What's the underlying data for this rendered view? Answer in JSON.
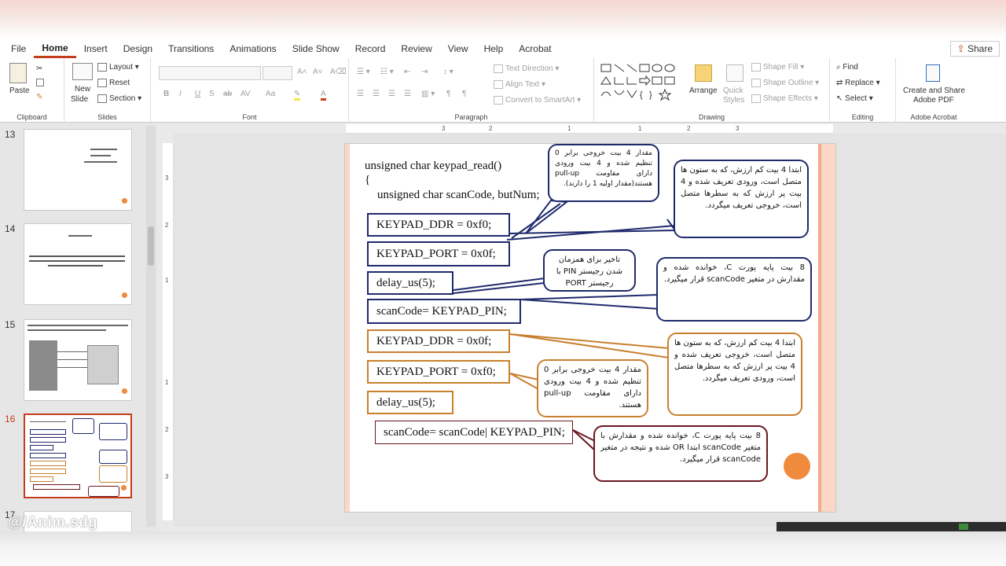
{
  "menu": {
    "items": [
      "File",
      "Home",
      "Insert",
      "Design",
      "Transitions",
      "Animations",
      "Slide Show",
      "Record",
      "Review",
      "View",
      "Help",
      "Acrobat"
    ],
    "active": "Home",
    "share_label": "Share"
  },
  "ribbon": {
    "clipboard": {
      "label": "Clipboard",
      "paste": "Paste"
    },
    "slides": {
      "label": "Slides",
      "new_slide": "New",
      "new_slide_2": "Slide",
      "layout": "Layout",
      "reset": "Reset",
      "section": "Section"
    },
    "font": {
      "label": "Font"
    },
    "paragraph": {
      "label": "Paragraph",
      "text_direction": "Text Direction",
      "align_text": "Align Text",
      "smartart": "Convert to SmartArt"
    },
    "drawing": {
      "label": "Drawing",
      "arrange": "Arrange",
      "quick_styles": "Quick Styles",
      "quick_styles_2": "Styles",
      "shape_fill": "Shape Fill",
      "shape_outline": "Shape Outline",
      "shape_effects": "Shape Effects"
    },
    "editing": {
      "label": "Editing",
      "find": "Find",
      "replace": "Replace",
      "select": "Select"
    },
    "acrobat": {
      "label": "Adobe Acrobat",
      "create": "Create and Share",
      "create_2": "Adobe PDF"
    }
  },
  "ruler": {
    "ticks": [
      "3",
      "2",
      "1",
      "",
      "1",
      "2",
      "3"
    ]
  },
  "thumbnails": [
    {
      "num": "13",
      "active": false
    },
    {
      "num": "14",
      "active": false
    },
    {
      "num": "15",
      "active": false
    },
    {
      "num": "16",
      "active": true
    },
    {
      "num": "17",
      "active": false
    }
  ],
  "slide": {
    "code_func": "unsigned char keypad_read()",
    "code_brace": "{",
    "code_decl": "unsigned char scanCode, butNum;",
    "box1": "KEYPAD_DDR = 0xf0;",
    "box2": "KEYPAD_PORT = 0x0f;",
    "box3": "delay_us(5);",
    "box4": "scanCode= KEYPAD_PIN;",
    "box5": "KEYPAD_DDR = 0x0f;",
    "box6": "KEYPAD_PORT = 0xf0;",
    "box7": "delay_us(5);",
    "box8": "scanCode= scanCode| KEYPAD_PIN;",
    "callout1": "مقدار 4 بیت خروجی برابر 0 تنظیم شده و 4 بیت ورودی دارای مقاومت pull-up هستند(مقدار اولیه 1 را دارند).",
    "callout2": "ابتدا 4 بیت کم ارزش، که به ستون ها متصل است، ورودی تعریف شده و 4 بیت پر ارزش که به سطرها متصل است، خروجی تعریف میگردد.",
    "callout3": "تاخیر برای همزمان شدن رجیستر PIN با رجیستر PORT",
    "callout4": "8 بیت پایه پورت C، خوانده شده و مقدارش در متغیر scanCode قرار میگیرد.",
    "callout5": "ابتدا 4 بیت کم ارزش، که به ستون ها متصل است، خروجی تعریف شده و 4 بیت پر ارزش که به سطرها متصل است، ورودی تعریف میگردد.",
    "callout6": "مقدار 4 بیت خروجی برابر 0 تنظیم شده و 4 بیت ورودی دارای مقاومت pull-up هستند.",
    "callout7": "8 بیت پایه پورت C، خوانده شده و مقدارش با متغیر scanCode ابتدا OR شده و نتیجه در متغیر scanCode قرار میگیرد."
  },
  "watermark": "@/Anim.sdg"
}
